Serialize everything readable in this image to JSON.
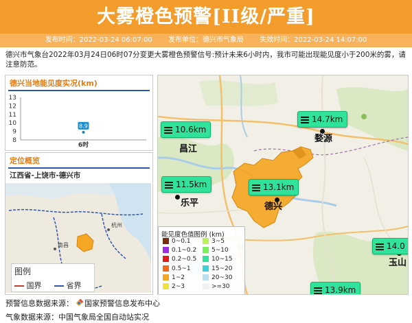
{
  "title": "大雾橙色预警[II级/严重]",
  "meta": {
    "issue_time": "发布时间：2022-03-24 06:07:00",
    "issuer": "发布单位：德兴市气象局",
    "expire_time": "失效时间：2022-03-24 14:07:00"
  },
  "description": "德兴市气象台2022年03月24日06时07分变更大雾橙色预警信号:预计未来6小时内，我市可能出现能见度小于200米的雾，请注意防范。",
  "visibility_panel": {
    "title": "德兴当地能见度实况(km)",
    "chart_data": {
      "type": "scatter",
      "categories": [
        "6时"
      ],
      "values": [
        8.9
      ],
      "ylim": [
        8,
        13
      ],
      "yticks": [
        "13",
        "12",
        "11",
        "10",
        "9",
        "8"
      ],
      "data_label": "8.9",
      "title": "德兴当地能见度实况(km)"
    }
  },
  "location_panel": {
    "title": "定位概览",
    "path": "江西省-上饶市-德兴市",
    "legend_title": "图例",
    "legend_items": [
      {
        "label": "国界",
        "color": "#c0392b"
      },
      {
        "label": "省界",
        "color": "#2f56a6"
      }
    ],
    "mini_map_labels": [
      "杭州",
      "南昌"
    ]
  },
  "map": {
    "labels": [
      {
        "text": "10.6km"
      },
      {
        "text": "14.7km"
      },
      {
        "text": "11.5km"
      },
      {
        "text": "13.1km"
      },
      {
        "text": "14.0"
      },
      {
        "text": "13.9km"
      }
    ],
    "cities": [
      "昌江",
      "婺源",
      "乐平",
      "德兴",
      "玉山"
    ],
    "alert_area_color": "#f5a623",
    "legend": {
      "title": "能见度色值图例 (km)",
      "items": [
        {
          "label": "0~0.1",
          "color": "#7b2d0b"
        },
        {
          "label": "3~5",
          "color": "#b9f25a"
        },
        {
          "label": "0.1~0.2",
          "color": "#9b2ce0"
        },
        {
          "label": "5~10",
          "color": "#7bf05b"
        },
        {
          "label": "0.2~0.5",
          "color": "#e11a1a"
        },
        {
          "label": "10~15",
          "color": "#31e39a"
        },
        {
          "label": "0.5~1",
          "color": "#f26b1d"
        },
        {
          "label": "15~20",
          "color": "#3fd1d8"
        },
        {
          "label": "1~2",
          "color": "#f5a623"
        },
        {
          "label": "20~30",
          "color": "#b9e0f2"
        },
        {
          "label": "2~3",
          "color": "#f2e23d"
        },
        {
          "label": ">=30",
          "color": "#f2f2f2"
        }
      ]
    }
  },
  "sources": {
    "warning_prefix": "预警信息数据来源：",
    "warning_source": "国家预警信息发布中心",
    "weather_prefix": "气象数据来源：",
    "weather_source": "中国气象局全国自动站实况"
  }
}
